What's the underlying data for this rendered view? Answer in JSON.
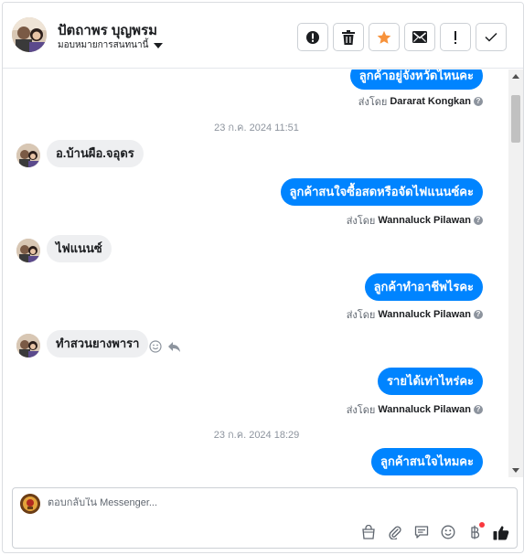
{
  "header": {
    "contact_name": "ปัตถาพร บุญพรม",
    "assign_label": "มอบหมายการสนทนานี้",
    "actions": [
      {
        "icon": "alert-circle-icon",
        "name": "spam-button"
      },
      {
        "icon": "trash-icon",
        "name": "delete-button"
      },
      {
        "icon": "star-icon",
        "name": "star-button"
      },
      {
        "icon": "mail-icon",
        "name": "mark-unread-button"
      },
      {
        "icon": "exclamation-icon",
        "name": "follow-up-button"
      },
      {
        "icon": "check-icon",
        "name": "mark-done-button"
      }
    ]
  },
  "messages": {
    "m0_out": "ลูกค้าอยู่จังหวัดไหนคะ",
    "m0_sent_prefix": "ส่งโดย",
    "m0_sent_by": "Dararat Kongkan",
    "ts1": "23 ก.ค. 2024 11:51",
    "m1_in": "อ.บ้านผือ.จอุดร",
    "m2_out": "ลูกค้าสนใจซื้อสดหรือจัดไฟแนนซ์คะ",
    "m2_sent_prefix": "ส่งโดย",
    "m2_sent_by": "Wannaluck Pilawan",
    "m3_in": "ไฟแนนซ์",
    "m4_out": "ลูกค้าทำอาชีพไรคะ",
    "m4_sent_prefix": "ส่งโดย",
    "m4_sent_by": "Wannaluck Pilawan",
    "m5_in": "ทำสวนยางพารา",
    "m6_out": "รายได้เท่าไหร่คะ",
    "m6_sent_prefix": "ส่งโดย",
    "m6_sent_by": "Wannaluck Pilawan",
    "ts2": "23 ก.ค. 2024 18:29",
    "m7_out": "ลูกค้าสนใจไหมคะ"
  },
  "composer": {
    "placeholder": "ตอบกลับใน Messenger...",
    "tools": [
      "shop-icon",
      "attachment-icon",
      "saved-replies-icon",
      "emoji-icon",
      "baht-payment-icon",
      "thumbs-up-icon"
    ]
  },
  "colors": {
    "accent": "#0084ff",
    "incoming_bubble": "#eeeff1",
    "star": "#f7923b",
    "notification": "#fa383e"
  }
}
